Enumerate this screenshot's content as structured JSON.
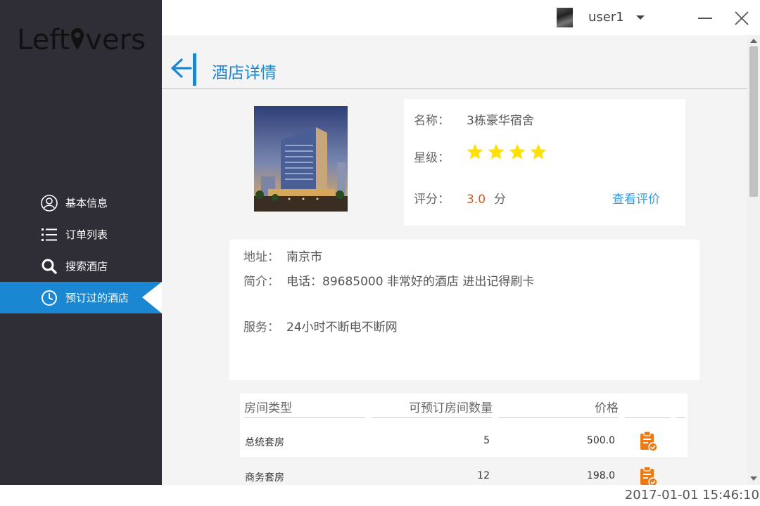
{
  "app": {
    "logo_pre": "Left",
    "logo_post": "vers"
  },
  "sidebar": {
    "items": [
      {
        "label": "基本信息",
        "icon": "user-circle-icon"
      },
      {
        "label": "订单列表",
        "icon": "list-icon"
      },
      {
        "label": "搜索酒店",
        "icon": "search-icon"
      },
      {
        "label": "预订过的酒店",
        "icon": "clock-icon",
        "active": true
      }
    ]
  },
  "topbar": {
    "username": "user1"
  },
  "page": {
    "title": "酒店详情"
  },
  "hotel": {
    "name_label": "名称：",
    "name": "3栋豪华宿舍",
    "star_label": "星级：",
    "stars": 4,
    "score_label": "评分：",
    "score": "3.0",
    "score_unit": "分",
    "view_reviews": "查看评价",
    "address_label": "地址：",
    "address": "南京市",
    "intro_label": "简介：",
    "intro": "电话：89685000 非常好的酒店 进出记得刷卡",
    "service_label": "服务：",
    "service": "24小时不断电不断网"
  },
  "rooms": {
    "headers": [
      "房间类型",
      "可预订房间数量",
      "价格"
    ],
    "rows": [
      {
        "type": "总统套房",
        "count": "5",
        "price": "500.0"
      },
      {
        "type": "商务套房",
        "count": "12",
        "price": "198.0"
      }
    ]
  },
  "status": {
    "datetime": "2017-01-01 15:46:10"
  },
  "colors": {
    "sidebar_bg": "#2f2e36",
    "accent": "#1a87d2",
    "star": "#ffe000",
    "score": "#d05a1c",
    "action": "#f07a10"
  }
}
